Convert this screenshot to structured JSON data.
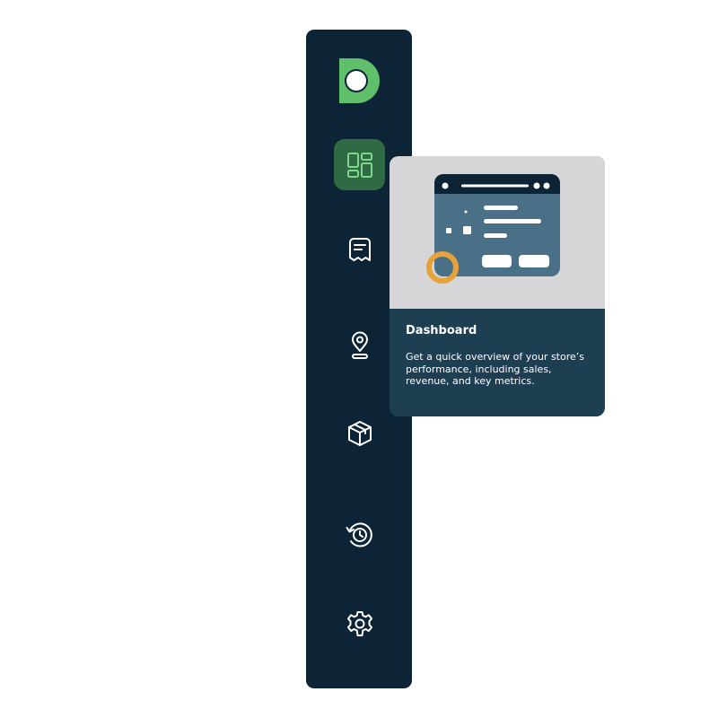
{
  "colors": {
    "sidebar_bg": "#0c2436",
    "active_item_bg": "#2f6a45",
    "accent_green": "#5fbf6a",
    "icon_color": "#ffffff",
    "tooltip_top_bg": "#d6d5d7",
    "tooltip_body_bg": "#1e3e52",
    "illustration_window": "#4a7087",
    "illustration_titlebar": "#0c2436",
    "illustration_ring": "#e7a33a"
  },
  "sidebar": {
    "logo_icon": "brand-logo-icon",
    "items": [
      {
        "id": "dashboard",
        "icon": "dashboard-icon",
        "active": true
      },
      {
        "id": "orders",
        "icon": "receipt-icon",
        "active": false
      },
      {
        "id": "locations",
        "icon": "location-pin-icon",
        "active": false
      },
      {
        "id": "products",
        "icon": "package-icon",
        "active": false
      },
      {
        "id": "history",
        "icon": "history-clock-icon",
        "active": false
      },
      {
        "id": "settings",
        "icon": "gear-icon",
        "active": false
      }
    ]
  },
  "tooltip": {
    "title": "Dashboard",
    "description": "Get a quick overview of your store’s performance, including sales, revenue, and key metrics."
  }
}
